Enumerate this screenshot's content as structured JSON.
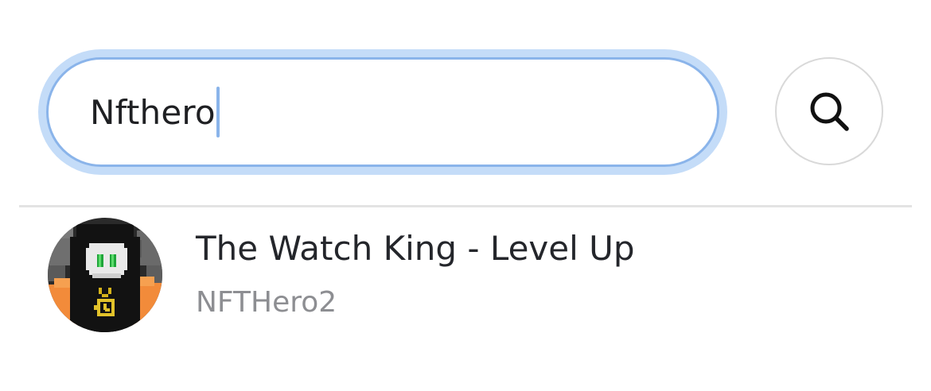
{
  "search": {
    "value": "Nfthero",
    "button_icon": "search-icon"
  },
  "results": [
    {
      "title": "The Watch King - Level Up",
      "subtitle": "NFTHero2",
      "avatar_icon": "pixel-hooded-character-avatar"
    }
  ],
  "colors": {
    "focus_ring": "#c4dcf8",
    "field_border": "#8ab4ea",
    "caret": "#8ab4ea",
    "title_text": "#24262b",
    "subtitle_text": "#8d8e92",
    "divider": "#e3e3e3"
  }
}
